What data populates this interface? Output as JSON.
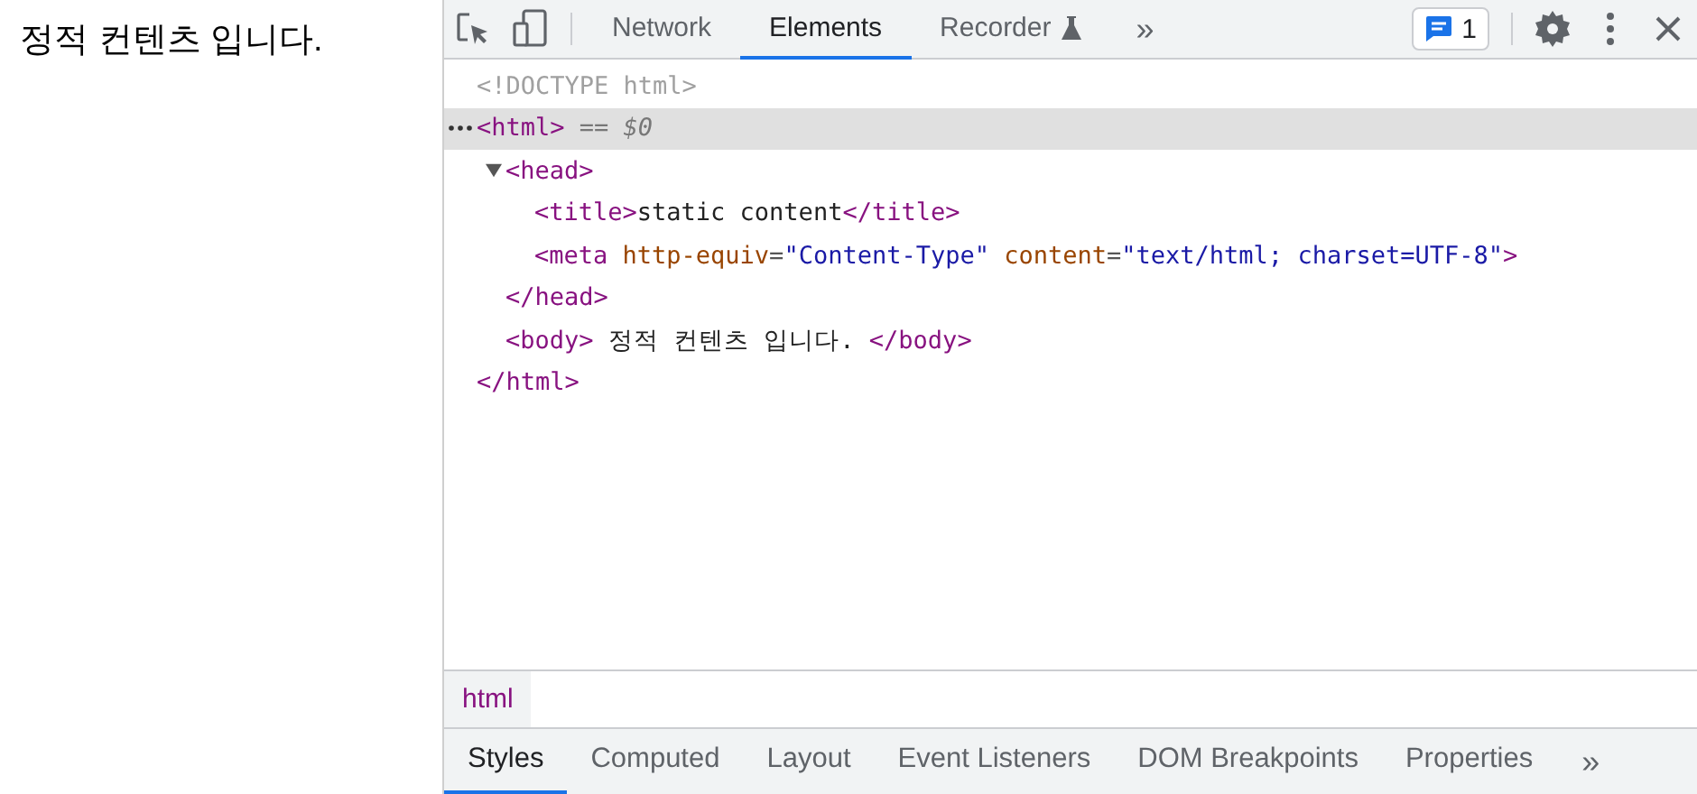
{
  "page": {
    "text": "정적 컨텐츠 입니다."
  },
  "toolbar": {
    "tabs": [
      {
        "label": "Network",
        "selected": false
      },
      {
        "label": "Elements",
        "selected": true
      },
      {
        "label": "Recorder",
        "selected": false,
        "kind": "flask"
      }
    ],
    "more": "»",
    "issues": {
      "count": "1"
    }
  },
  "dom_tree": [
    {
      "selected": false,
      "tokens": [
        {
          "kind": "doctype",
          "text": "<!DOCTYPE html>"
        }
      ]
    },
    {
      "selected": true,
      "tokens": [
        {
          "kind": "tag",
          "text": "<html>"
        },
        {
          "kind": "note",
          "text": " == $0"
        }
      ],
      "children": [
        {
          "selected": false,
          "expanded": true,
          "tokens": [
            {
              "kind": "tag",
              "text": "<head>"
            }
          ],
          "children": [
            {
              "selected": false,
              "tokens": [
                {
                  "kind": "tag",
                  "text": "<title>"
                },
                {
                  "kind": "text",
                  "text": "static content"
                },
                {
                  "kind": "tag",
                  "text": "</title>"
                }
              ]
            },
            {
              "selected": false,
              "tokens": [
                {
                  "kind": "tag",
                  "text": "<meta"
                },
                {
                  "kind": "attr",
                  "text": " http-equiv"
                },
                {
                  "kind": "punct",
                  "text": "="
                },
                {
                  "kind": "value",
                  "text": "\"Content-Type\""
                },
                {
                  "kind": "attr",
                  "text": " content"
                },
                {
                  "kind": "punct",
                  "text": "="
                },
                {
                  "kind": "value",
                  "text": "\"text/html; charset=UTF-8\""
                },
                {
                  "kind": "tag",
                  "text": ">"
                }
              ]
            }
          ]
        },
        {
          "selected": false,
          "tokens": [
            {
              "kind": "tag",
              "text": "</head>"
            }
          ]
        },
        {
          "selected": false,
          "tokens": [
            {
              "kind": "tag",
              "text": "<body>"
            },
            {
              "kind": "text",
              "text": " 정적 컨텐츠 입니다. "
            },
            {
              "kind": "tag",
              "text": "</body>"
            }
          ]
        }
      ]
    },
    {
      "selected": false,
      "tokens": [
        {
          "kind": "tag",
          "text": "</html>"
        }
      ]
    }
  ],
  "breadcrumbs": [
    {
      "label": "html",
      "selected": true
    }
  ],
  "panel_tabs": {
    "tabs": [
      {
        "label": "Styles",
        "selected": true
      },
      {
        "label": "Computed",
        "selected": false
      },
      {
        "label": "Layout",
        "selected": false
      },
      {
        "label": "Event Listeners",
        "selected": false
      },
      {
        "label": "DOM Breakpoints",
        "selected": false
      },
      {
        "label": "Properties",
        "selected": false
      }
    ],
    "more": "»"
  }
}
